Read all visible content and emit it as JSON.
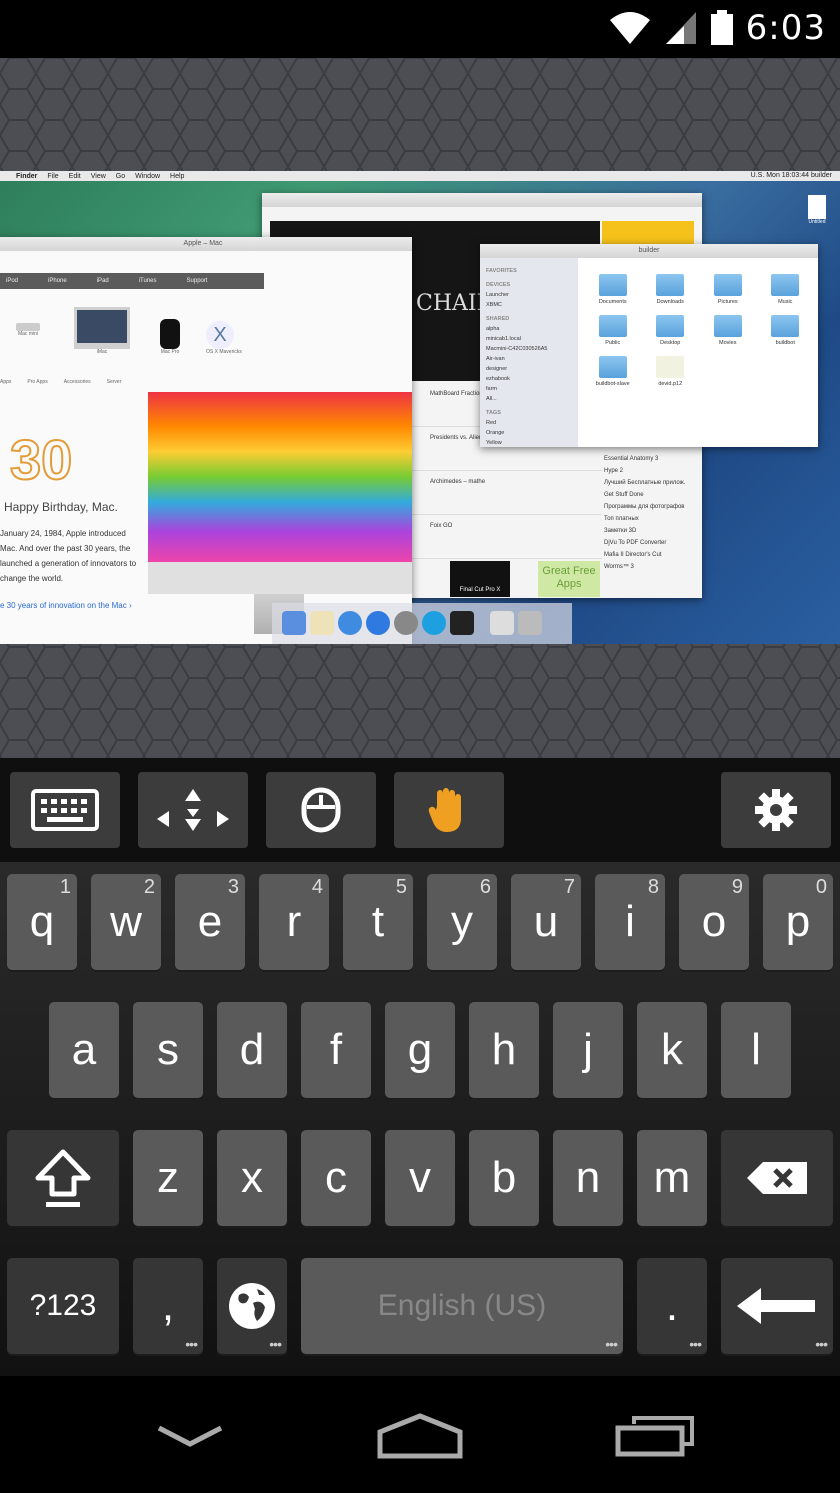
{
  "status_bar": {
    "time": "6:03",
    "icons": [
      "wifi-icon",
      "signal-icon",
      "battery-icon"
    ]
  },
  "remote": {
    "menubar": {
      "items": [
        "Finder",
        "File",
        "Edit",
        "View",
        "Go",
        "Window",
        "Help"
      ],
      "right_text": "U.S.  Mon 18:03:44  builder"
    },
    "app_store": {
      "title_text": "CHAIR",
      "list_items": [
        "MathBoard Fractions",
        "Presidents vs. Aliens",
        "Archimedes – mathe",
        "Foix GO"
      ],
      "side_items": [
        "Essential Anatomy 3",
        "Hype 2",
        "Лучший Бесплатные прилож.",
        "Get Stuff Done",
        "Программы для фотографов",
        "Топ платных",
        "Заметки 3D",
        "DjVu To PDF Converter",
        "Mafia II Director's Cut",
        "Worms™ 3"
      ],
      "green_tile": "Great Free Apps",
      "fcp_label": "Final Cut Pro X"
    },
    "safari": {
      "title": "Apple – Mac",
      "nav_items": [
        "iPod",
        "iPhone",
        "iPad",
        "iTunes",
        "Support"
      ],
      "products": [
        "Mac mini",
        "iMac",
        "Mac Pro",
        "OS X Mavericks"
      ],
      "sub_nav": [
        "Apps",
        "Pro Apps",
        "Accessories",
        "Server"
      ],
      "bday_number": "30",
      "bday_title": "Happy Birthday, Mac.",
      "bday_text": "January 24, 1984, Apple introduced Mac. And over the past 30 years, the launched a generation of innovators to change the world.",
      "bday_link": "e 30 years of innovation on the Mac ›"
    },
    "finder": {
      "title": "builder",
      "sidebar": [
        {
          "type": "header",
          "label": "FAVORITES"
        },
        {
          "type": "header",
          "label": "DEVICES"
        },
        {
          "type": "item",
          "label": "Launcher"
        },
        {
          "type": "item",
          "label": "XBMC"
        },
        {
          "type": "header",
          "label": "SHARED"
        },
        {
          "type": "item",
          "label": "alpha"
        },
        {
          "type": "item",
          "label": "minicab1.local"
        },
        {
          "type": "item",
          "label": "Macmini-C42C030526A5"
        },
        {
          "type": "item",
          "label": "Air-ivan"
        },
        {
          "type": "item",
          "label": "designer"
        },
        {
          "type": "item",
          "label": "ezhabook"
        },
        {
          "type": "item",
          "label": "farm"
        },
        {
          "type": "item",
          "label": "All..."
        },
        {
          "type": "header",
          "label": "TAGS"
        },
        {
          "type": "item",
          "label": "Red"
        },
        {
          "type": "item",
          "label": "Orange"
        },
        {
          "type": "item",
          "label": "Yellow"
        }
      ],
      "folders": [
        "Documents",
        "Downloads",
        "Pictures",
        "Music",
        "Public",
        "Desktop",
        "Movies",
        "buildbot",
        "buildbot-slave",
        "devid.p12"
      ]
    },
    "desktop_file": "Untitled"
  },
  "toolbar": {
    "buttons": [
      {
        "name": "keyboard-toggle-button",
        "icon": "keyboard-icon"
      },
      {
        "name": "move-mode-button",
        "icon": "arrows-icon"
      },
      {
        "name": "mouse-mode-button",
        "icon": "mouse-icon"
      },
      {
        "name": "touch-mode-button",
        "icon": "hand-icon"
      },
      {
        "name": "settings-button",
        "icon": "gear-icon"
      }
    ],
    "active_color": "#f0a020"
  },
  "keyboard": {
    "row1": [
      {
        "k": "q",
        "h": "1"
      },
      {
        "k": "w",
        "h": "2"
      },
      {
        "k": "e",
        "h": "3"
      },
      {
        "k": "r",
        "h": "4"
      },
      {
        "k": "t",
        "h": "5"
      },
      {
        "k": "y",
        "h": "6"
      },
      {
        "k": "u",
        "h": "7"
      },
      {
        "k": "i",
        "h": "8"
      },
      {
        "k": "o",
        "h": "9"
      },
      {
        "k": "p",
        "h": "0"
      }
    ],
    "row2": [
      "a",
      "s",
      "d",
      "f",
      "g",
      "h",
      "j",
      "k",
      "l"
    ],
    "row3": [
      "z",
      "x",
      "c",
      "v",
      "b",
      "n",
      "m"
    ],
    "symbols_label": "?123",
    "comma": ",",
    "period": ".",
    "space_label": "English (US)"
  },
  "navbar": {
    "buttons": [
      "back-icon",
      "home-icon",
      "recents-icon"
    ]
  }
}
